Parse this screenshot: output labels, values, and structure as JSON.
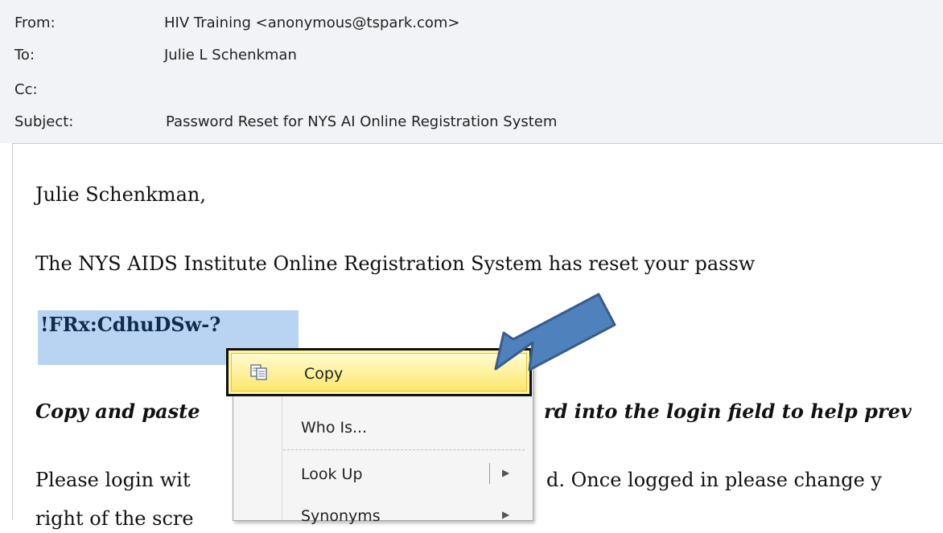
{
  "email": {
    "from_label": "From:",
    "from_value": "HIV Training <anonymous@tspark.com>",
    "to_label": "To:",
    "to_value": "Julie L Schenkman",
    "cc_label": "Cc:",
    "subject_label": "Subject:",
    "subject_value": "Password Reset for NYS AI Online Registration System"
  },
  "body": {
    "greeting": "Julie Schenkman,",
    "line1": "The NYS AIDS Institute Online Registration System has reset your passw",
    "password": "!FRx:CdhuDSw-?",
    "line2": "Copy and paste ",
    "line2_b": "rd into the login field to help prev",
    "line3": "Please login wit",
    "line3_b": "d. Once logged in please change y",
    "line4": "right of the scre"
  },
  "context_menu": {
    "copy": "Copy",
    "who_is": "Who Is...",
    "look_up": "Look Up",
    "synonyms": "Synonyms"
  }
}
